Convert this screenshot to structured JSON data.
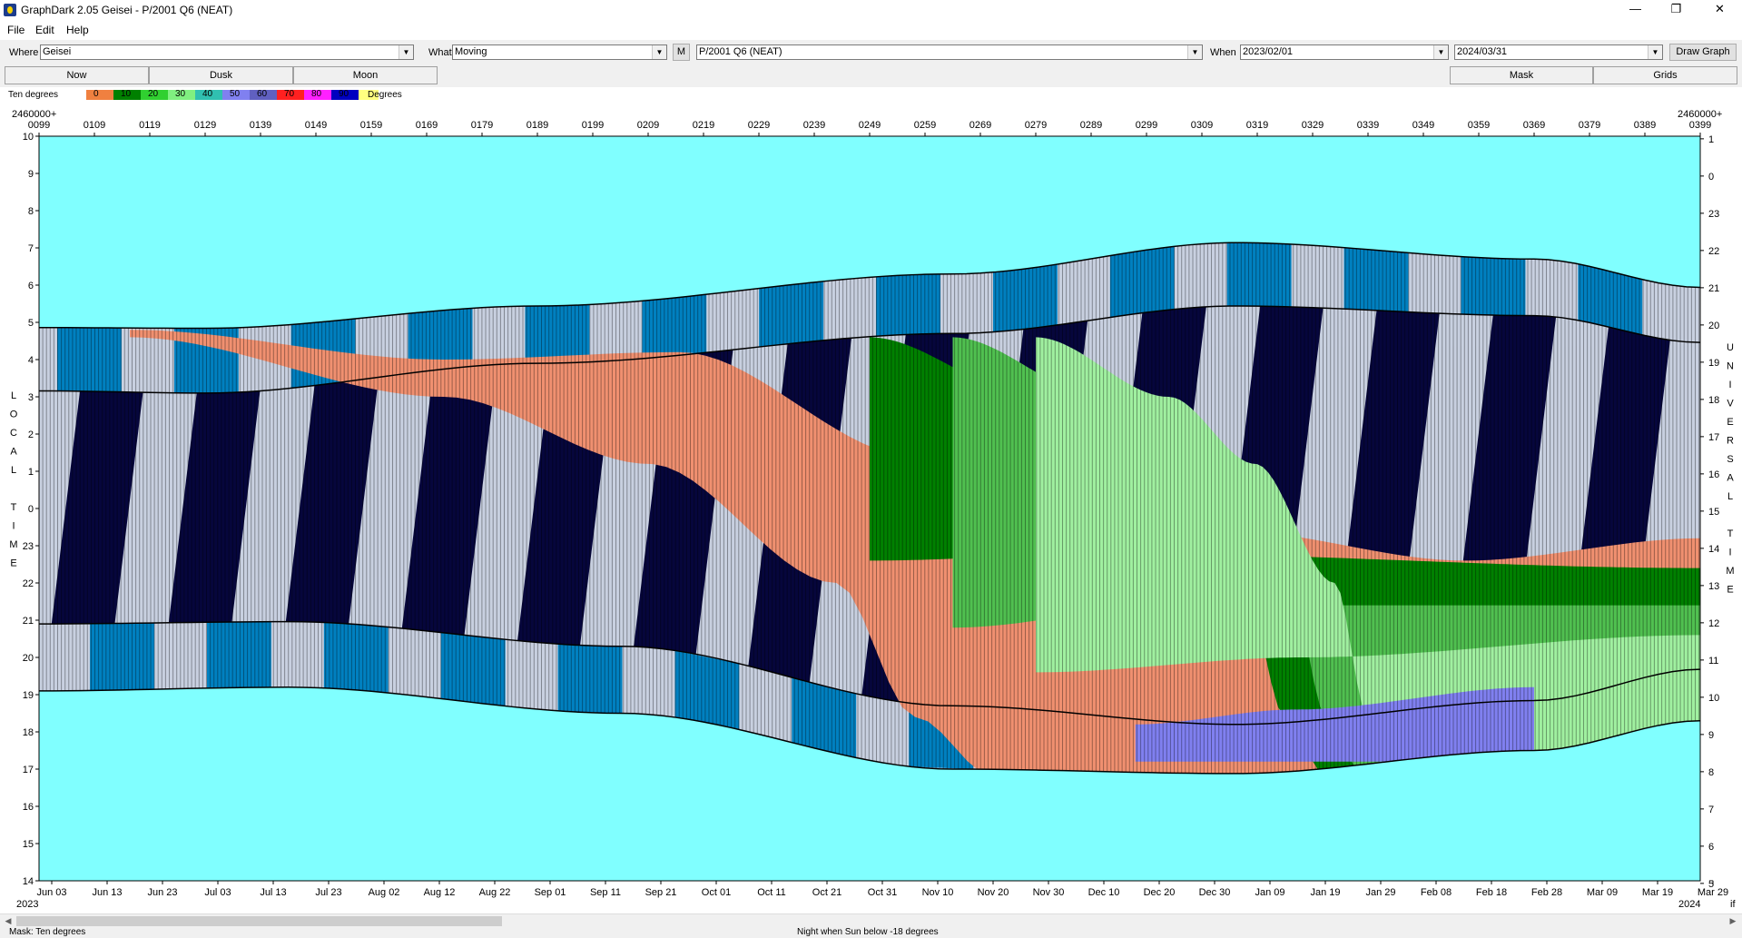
{
  "window": {
    "title": "GraphDark 2.05  Geisei  -  P/2001 Q6 (NEAT)",
    "minimize": "—",
    "maximize": "❐",
    "close": "✕"
  },
  "menu": {
    "file": "File",
    "edit": "Edit",
    "help": "Help"
  },
  "toolbar": {
    "where_label": "Where",
    "where_value": "Geisei",
    "what_label": "What",
    "what_value": "Moving",
    "m_button": "M",
    "object_value": "P/2001 Q6 (NEAT)",
    "when_label": "When",
    "start_date": "2023/02/01",
    "end_date": "2024/03/31",
    "draw_button": "Draw Graph"
  },
  "tabs": {
    "now": "Now",
    "dusk": "Dusk",
    "moon": "Moon",
    "mask": "Mask",
    "grids": "Grids"
  },
  "legend": {
    "label": "Ten degrees",
    "unit": "Degrees",
    "swatches": [
      {
        "value": "0",
        "color": "#f08040"
      },
      {
        "value": "10",
        "color": "#008000"
      },
      {
        "value": "20",
        "color": "#30d030"
      },
      {
        "value": "30",
        "color": "#80f080"
      },
      {
        "value": "40",
        "color": "#30c0b0"
      },
      {
        "value": "50",
        "color": "#8080f0"
      },
      {
        "value": "60",
        "color": "#6060c0"
      },
      {
        "value": "70",
        "color": "#ff2020"
      },
      {
        "value": "80",
        "color": "#ff20ff"
      },
      {
        "value": "90",
        "color": "#0000c0"
      }
    ],
    "end_color": "#ffff80"
  },
  "graph": {
    "jd_prefix_left": "2460000+",
    "jd_prefix_right": "2460000+",
    "jd_ticks": [
      "0099",
      "0109",
      "0119",
      "0129",
      "0139",
      "0149",
      "0159",
      "0169",
      "0179",
      "0189",
      "0199",
      "0209",
      "0219",
      "0229",
      "0239",
      "0249",
      "0259",
      "0269",
      "0279",
      "0289",
      "0299",
      "0309",
      "0319",
      "0329",
      "0339",
      "0349",
      "0359",
      "0369",
      "0379",
      "0389",
      "0399"
    ],
    "date_ticks": [
      "Jun 03",
      "Jun 13",
      "Jun 23",
      "Jul 03",
      "Jul 13",
      "Jul 23",
      "Aug 02",
      "Aug 12",
      "Aug 22",
      "Sep 01",
      "Sep 11",
      "Sep 21",
      "Oct 01",
      "Oct 11",
      "Oct 21",
      "Oct 31",
      "Nov 10",
      "Nov 20",
      "Nov 30",
      "Dec 10",
      "Dec 20",
      "Dec 30",
      "Jan 09",
      "Jan 19",
      "Jan 29",
      "Feb 08",
      "Feb 18",
      "Feb 28",
      "Mar 09",
      "Mar 19",
      "Mar 29"
    ],
    "left_time_ticks": [
      "10",
      "9",
      "8",
      "7",
      "6",
      "5",
      "4",
      "3",
      "2",
      "1",
      "0",
      "23",
      "22",
      "21",
      "20",
      "19",
      "18",
      "17",
      "16",
      "15",
      "14"
    ],
    "right_time_ticks": [
      "1",
      "0",
      "23",
      "22",
      "21",
      "20",
      "19",
      "18",
      "17",
      "16",
      "15",
      "14",
      "13",
      "12",
      "11",
      "10",
      "9",
      "8",
      "7",
      "6",
      "5"
    ],
    "left_axis_letters": [
      "L",
      "O",
      "C",
      "A",
      "L",
      " ",
      "T",
      "I",
      "M",
      "E"
    ],
    "right_axis_letters": [
      "U",
      "N",
      "I",
      "V",
      "E",
      "R",
      "S",
      "A",
      "L",
      " ",
      "T",
      "I",
      "M",
      "E"
    ],
    "year_left": "2023",
    "year_right": "2024",
    "corner_label": "if",
    "colors": {
      "day": "#80ffff",
      "night": "#06063c",
      "twilight_blue": "#0080c0",
      "twilight_grey": "#c8d0e0",
      "comet_low": "#f09070",
      "comet_green_dark": "#008000",
      "comet_green_mid": "#50c050",
      "comet_green_light": "#a0f0a0",
      "comet_blue": "#8080f0"
    }
  },
  "status": {
    "mask_text": "Mask:  Ten degrees",
    "night_text": "Night when Sun below -18 degrees"
  }
}
